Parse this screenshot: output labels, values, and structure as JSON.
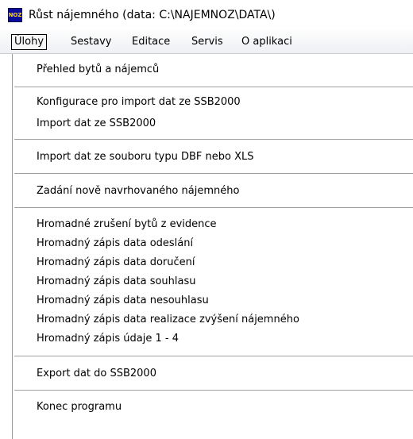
{
  "window": {
    "icon_text": "NOZ",
    "title": "Růst nájemného (data: C:\\NAJEMNOZ\\DATA\\)"
  },
  "menubar": {
    "items": [
      "Úlohy",
      "Sestavy",
      "Editace",
      "Servis",
      "O aplikaci"
    ]
  },
  "dropdown": {
    "items": [
      "Přehled bytů a nájemců",
      "Konfigurace pro import dat ze SSB2000",
      "Import dat ze SSB2000",
      "Import dat ze souboru typu DBF nebo XLS",
      "Zadání nově navrhovaného nájemného",
      "Hromadné zrušení bytů z evidence",
      "Hromadný zápis data odeslání",
      "Hromadný zápis data doručení",
      "Hromadný zápis data souhlasu",
      "Hromadný zápis data nesouhlasu",
      "Hromadný zápis data realizace zvýšení nájemného",
      "Hromadný zápis údaje 1 - 4",
      "Export dat do SSB2000",
      "Konec programu"
    ]
  },
  "colors": {
    "icon_bg": "#0a0a9c",
    "icon_text": "#ffd800",
    "separator": "#a0a0a0"
  }
}
